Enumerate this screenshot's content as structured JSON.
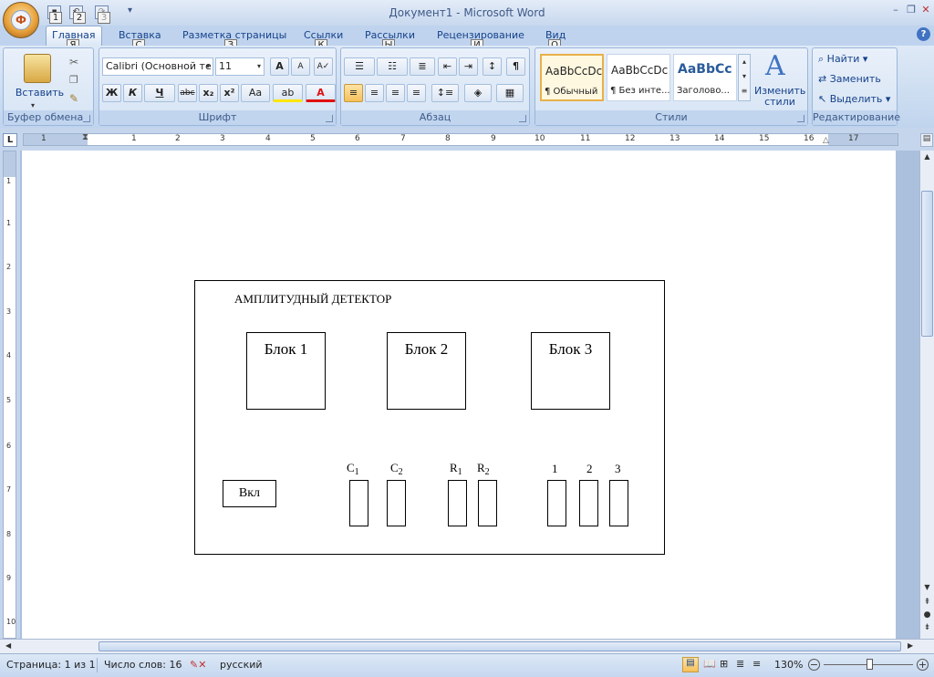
{
  "window": {
    "title": "Документ1 - Microsoft Word"
  },
  "office_button": {
    "label": "Ф"
  },
  "quick_access": {
    "keytips": [
      "1",
      "2",
      "3"
    ]
  },
  "tabs": [
    {
      "label": "Главная",
      "keytip": "Я"
    },
    {
      "label": "Вставка",
      "keytip": "С"
    },
    {
      "label": "Разметка страницы",
      "keytip": "З"
    },
    {
      "label": "Ссылки",
      "keytip": "К"
    },
    {
      "label": "Рассылки",
      "keytip": "Ы"
    },
    {
      "label": "Рецензирование",
      "keytip": "И"
    },
    {
      "label": "Вид",
      "keytip": "О"
    }
  ],
  "ribbon": {
    "clipboard": {
      "paste_label": "Вставить",
      "group_label": "Буфер обмена"
    },
    "font": {
      "font_name": "Calibri (Основной те",
      "font_size": "11",
      "group_label": "Шрифт",
      "bold": "Ж",
      "italic": "К",
      "underline": "Ч",
      "strike": "abc",
      "subscript": "x₂",
      "superscript": "x²",
      "case": "Aa",
      "grow": "A",
      "shrink": "A"
    },
    "paragraph": {
      "group_label": "Абзац",
      "pilcrow": "¶"
    },
    "styles": {
      "group_label": "Стили",
      "items": [
        {
          "sample": "AaBbCcDc",
          "name": "¶ Обычный"
        },
        {
          "sample": "AaBbCcDc",
          "name": "¶ Без инте..."
        },
        {
          "sample": "AaBbCc",
          "name": "Заголово..."
        }
      ],
      "change_styles": "Изменить стили"
    },
    "editing": {
      "group_label": "Редактирование",
      "find": "Найти",
      "replace": "Заменить",
      "select": "Выделить"
    }
  },
  "ruler": {
    "h_ticks": [
      "1",
      "1",
      "2",
      "3",
      "4",
      "5",
      "6",
      "7",
      "8",
      "9",
      "10",
      "11",
      "12",
      "13",
      "14",
      "15",
      "16",
      "17"
    ],
    "v_ticks": [
      "1",
      "1",
      "2",
      "3",
      "4",
      "5",
      "6",
      "7",
      "8",
      "9",
      "10"
    ]
  },
  "document": {
    "title": "АМПЛИТУДНЫЙ ДЕТЕКТОР",
    "blocks": [
      "Блок 1",
      "Блок 2",
      "Блок 3"
    ],
    "power_button": "Вкл",
    "c1": "C",
    "c1_sub": "1",
    "c2": "C",
    "c2_sub": "2",
    "r1": "R",
    "r1_sub": "1",
    "r2": "R",
    "r2_sub": "2",
    "points": [
      "1",
      "2",
      "3"
    ]
  },
  "status": {
    "page": "Страница: 1 из 1",
    "words": "Число слов: 16",
    "language": "русский",
    "zoom": "130%"
  },
  "colors": {
    "accent": "#15428b",
    "ribbon_bg": "#dfe9f6",
    "font_red": "#e01010",
    "highlight": "#ffe600"
  }
}
